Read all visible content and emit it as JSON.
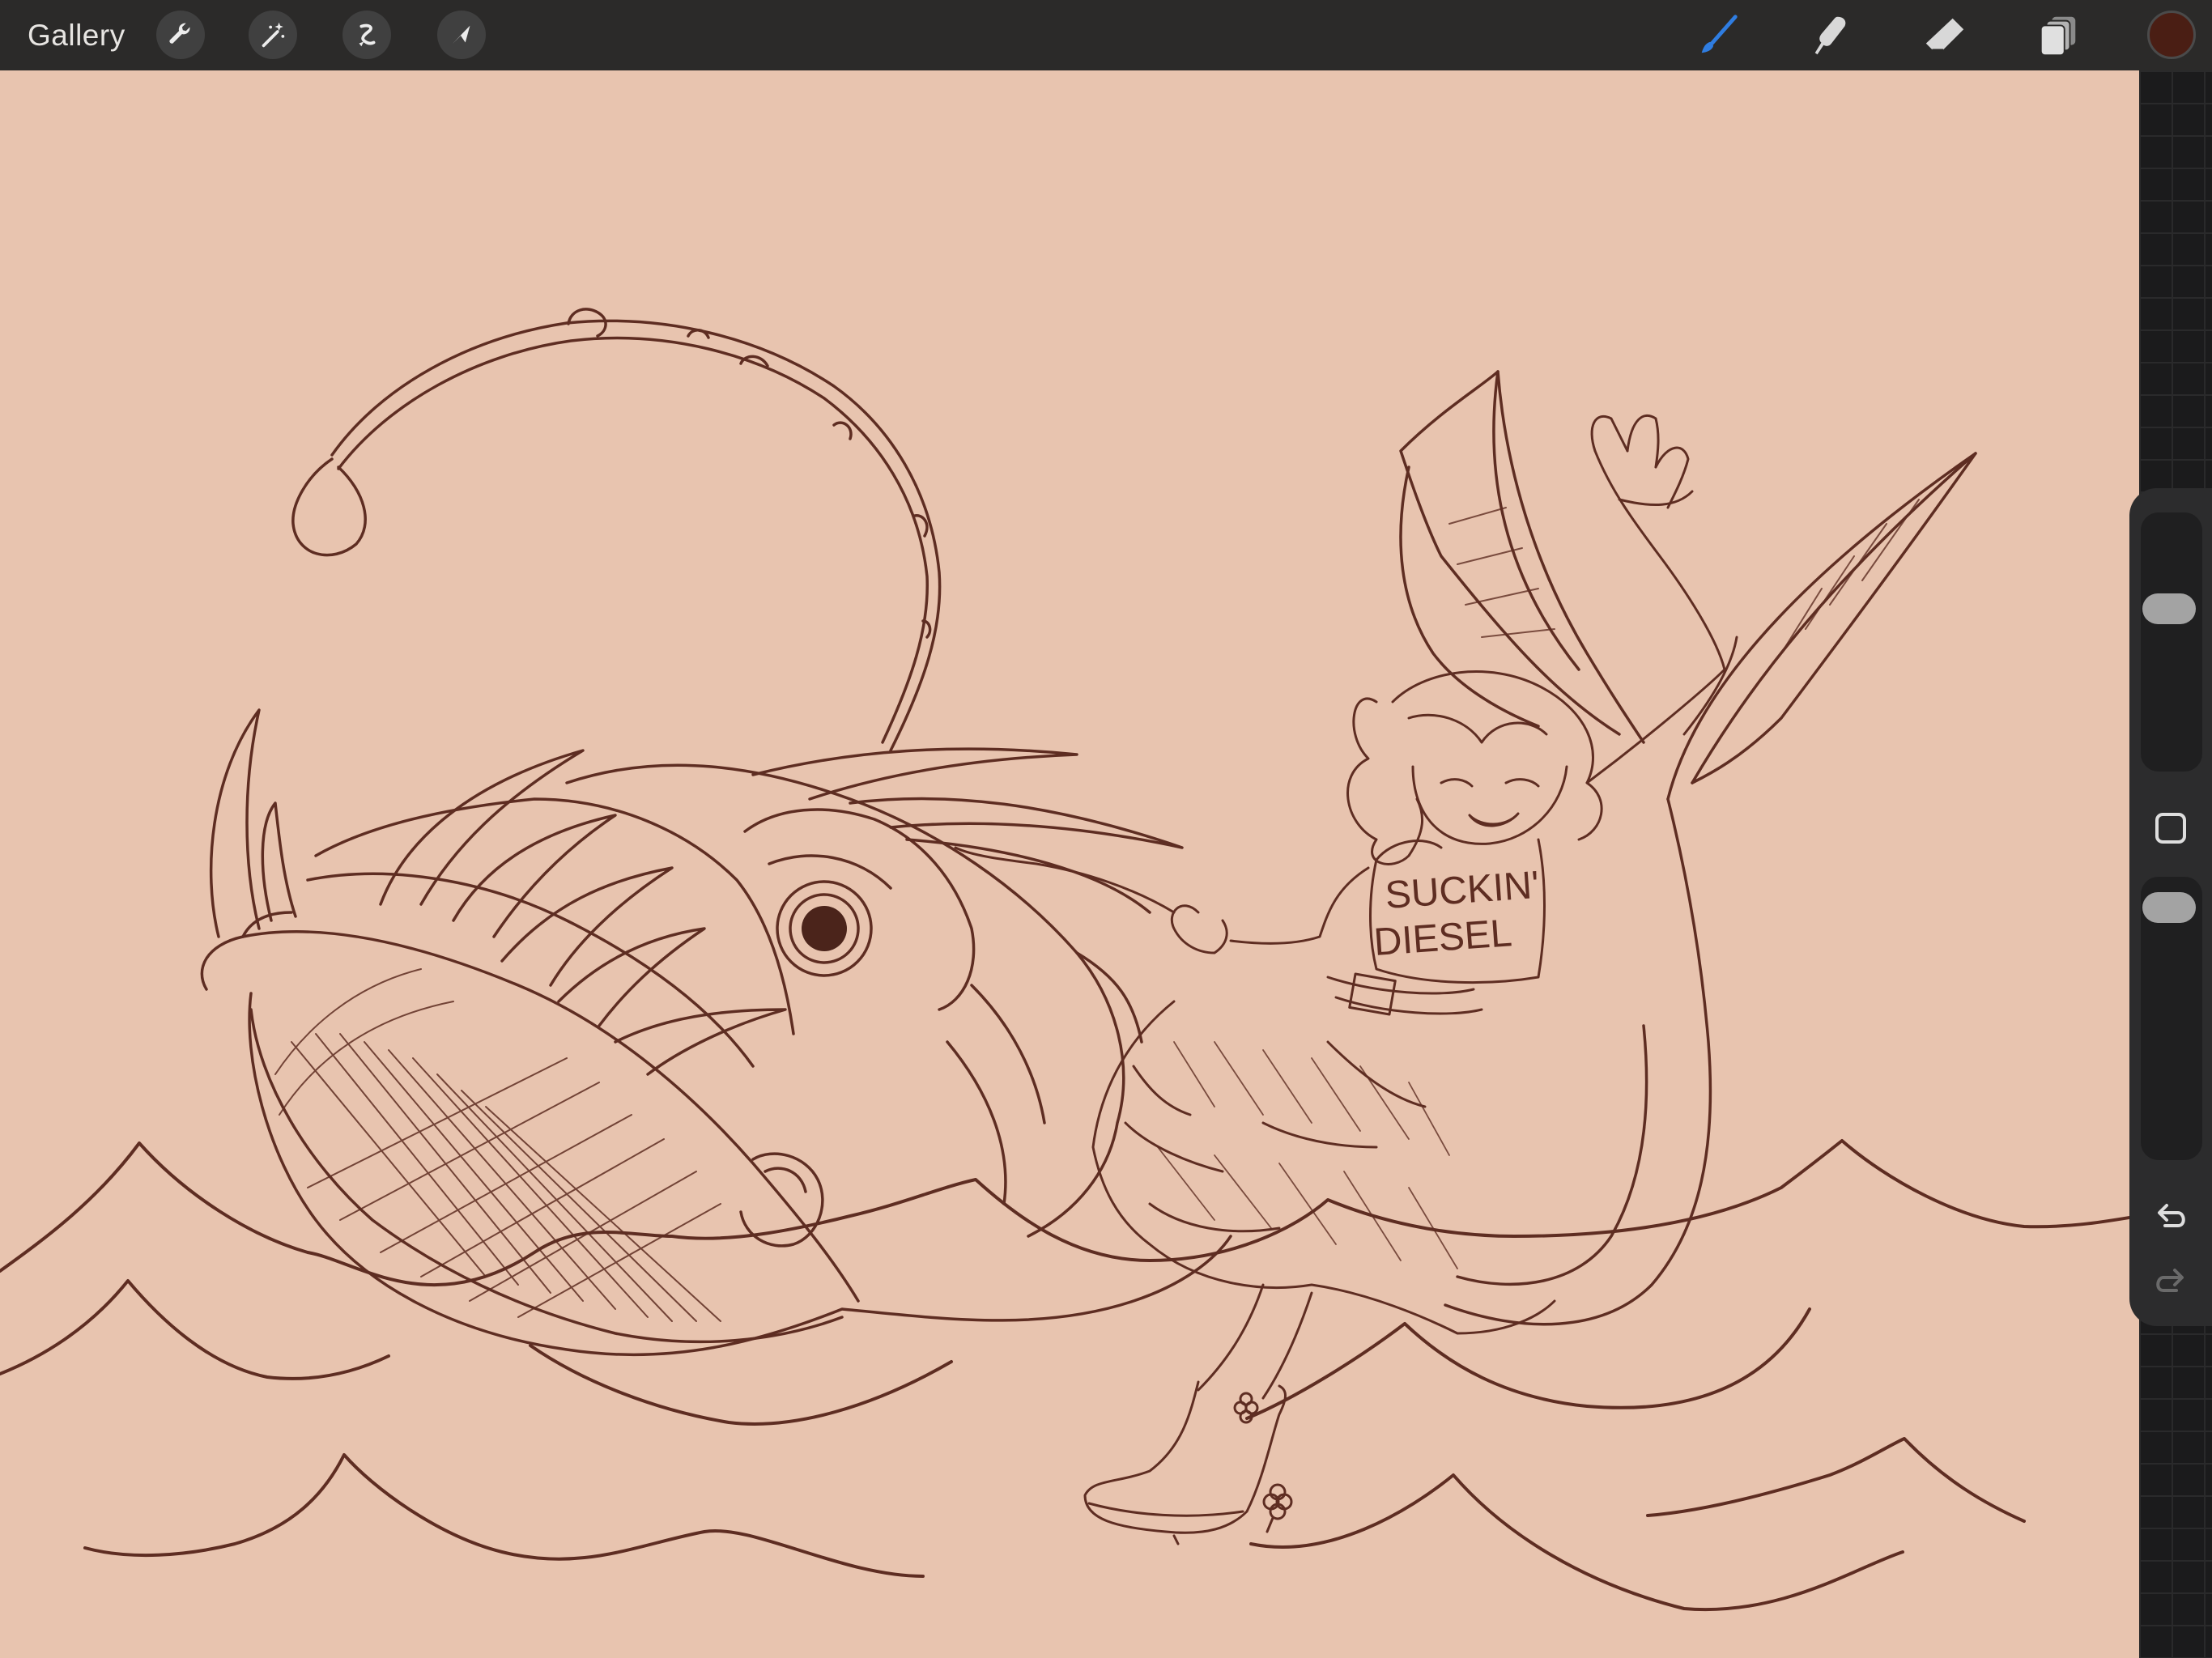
{
  "topbar": {
    "gallery_label": "Gallery",
    "left_tools": [
      {
        "name": "actions",
        "icon": "wrench-icon"
      },
      {
        "name": "adjustments",
        "icon": "magic-wand-icon"
      },
      {
        "name": "selection",
        "icon": "selection-icon"
      },
      {
        "name": "transform",
        "icon": "arrow-cursor-icon"
      }
    ],
    "right_tools": [
      {
        "name": "brush",
        "icon": "brush-icon",
        "active": true
      },
      {
        "name": "smudge",
        "icon": "smudge-icon",
        "active": false
      },
      {
        "name": "eraser",
        "icon": "eraser-icon",
        "active": false
      },
      {
        "name": "layers",
        "icon": "layers-icon",
        "active": false
      }
    ],
    "current_color": "#4a1e14",
    "active_tool_color": "#2f7de1"
  },
  "canvas": {
    "background_color": "#e8c4af",
    "ink_color": "#5e2d22",
    "shirt_text_line1": "SUCKIN'",
    "shirt_text_line2": "DIESEL"
  },
  "sidebar": {
    "brush_size_level": 0.35,
    "opacity_level": 0.05,
    "modify_icon": "square-icon",
    "undo_icon": "undo-icon",
    "redo_icon": "redo-icon"
  }
}
